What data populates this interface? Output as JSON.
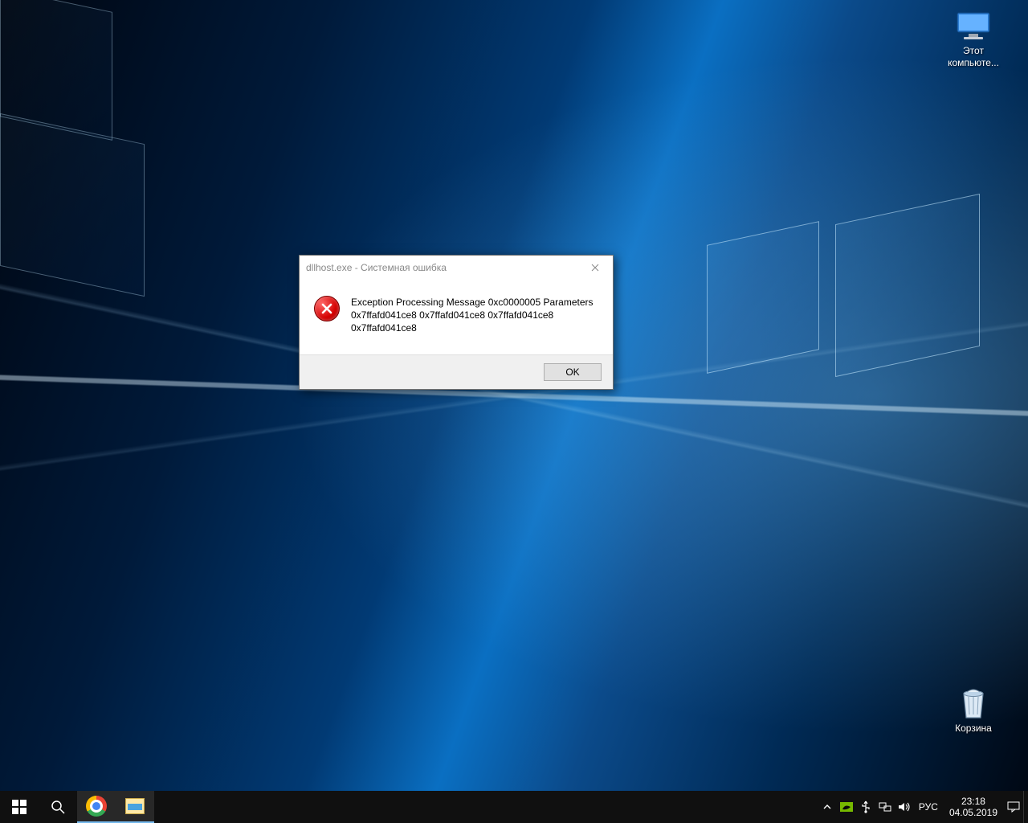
{
  "desktop": {
    "icons": {
      "this_pc": {
        "label": "Этот компьюте..."
      },
      "recycle_bin": {
        "label": "Корзина"
      }
    }
  },
  "dialog": {
    "title": "dllhost.exe - Системная ошибка",
    "message_line1": "Exception Processing Message 0xc0000005 Parameters",
    "message_line2": "0x7ffafd041ce8 0x7ffafd041ce8 0x7ffafd041ce8 0x7ffafd041ce8",
    "ok_label": "OK"
  },
  "taskbar": {
    "language": "РУС",
    "time": "23:18",
    "date": "04.05.2019"
  }
}
